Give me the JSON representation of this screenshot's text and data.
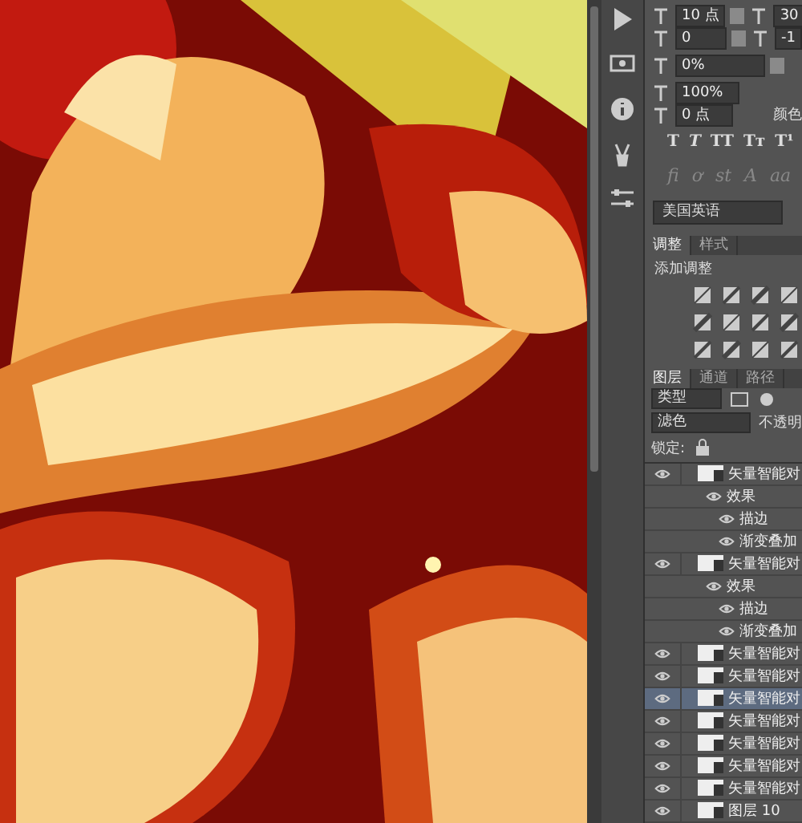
{
  "character_panel": {
    "font_size": "10 点",
    "leading": "30",
    "kerning": "0",
    "tracking": "-1",
    "baseline_scale": "0%",
    "vertical_scale": "100%",
    "baseline_shift": "0 点",
    "color_label": "颜色",
    "type_styles": [
      "T",
      "T",
      "TT",
      "Tт",
      "T¹"
    ],
    "opentype": [
      "fi",
      "ơ",
      "st",
      "A",
      "aa"
    ],
    "language": "美国英语"
  },
  "adjust_tabs": [
    {
      "label": "调整",
      "selected": true
    },
    {
      "label": "样式",
      "selected": false
    }
  ],
  "adjust_title": "添加调整",
  "layer_tabs": [
    {
      "label": "图层",
      "selected": true
    },
    {
      "label": "通道",
      "selected": false
    },
    {
      "label": "路径",
      "selected": false
    }
  ],
  "filter": "类型",
  "blend_mode": "滤色",
  "opacity_label": "不透明",
  "lock_label": "锁定:",
  "layers": [
    {
      "name": "矢量智能对",
      "visible": true,
      "selected": false,
      "children": [
        {
          "name": "效果",
          "children": [
            {
              "name": "描边"
            },
            {
              "name": "渐变叠加"
            }
          ]
        }
      ]
    },
    {
      "name": "矢量智能对",
      "visible": true,
      "selected": false,
      "children": [
        {
          "name": "效果",
          "children": [
            {
              "name": "描边"
            },
            {
              "name": "渐变叠加"
            }
          ]
        }
      ]
    },
    {
      "name": "矢量智能对",
      "visible": true,
      "selected": false
    },
    {
      "name": "矢量智能对",
      "visible": true,
      "selected": false
    },
    {
      "name": "矢量智能对",
      "visible": true,
      "selected": true
    },
    {
      "name": "矢量智能对",
      "visible": true,
      "selected": false
    },
    {
      "name": "矢量智能对",
      "visible": true,
      "selected": false
    },
    {
      "name": "矢量智能对",
      "visible": true,
      "selected": false
    },
    {
      "name": "矢量智能对",
      "visible": true,
      "selected": false
    },
    {
      "name": "图层 10",
      "visible": true,
      "selected": false
    }
  ]
}
